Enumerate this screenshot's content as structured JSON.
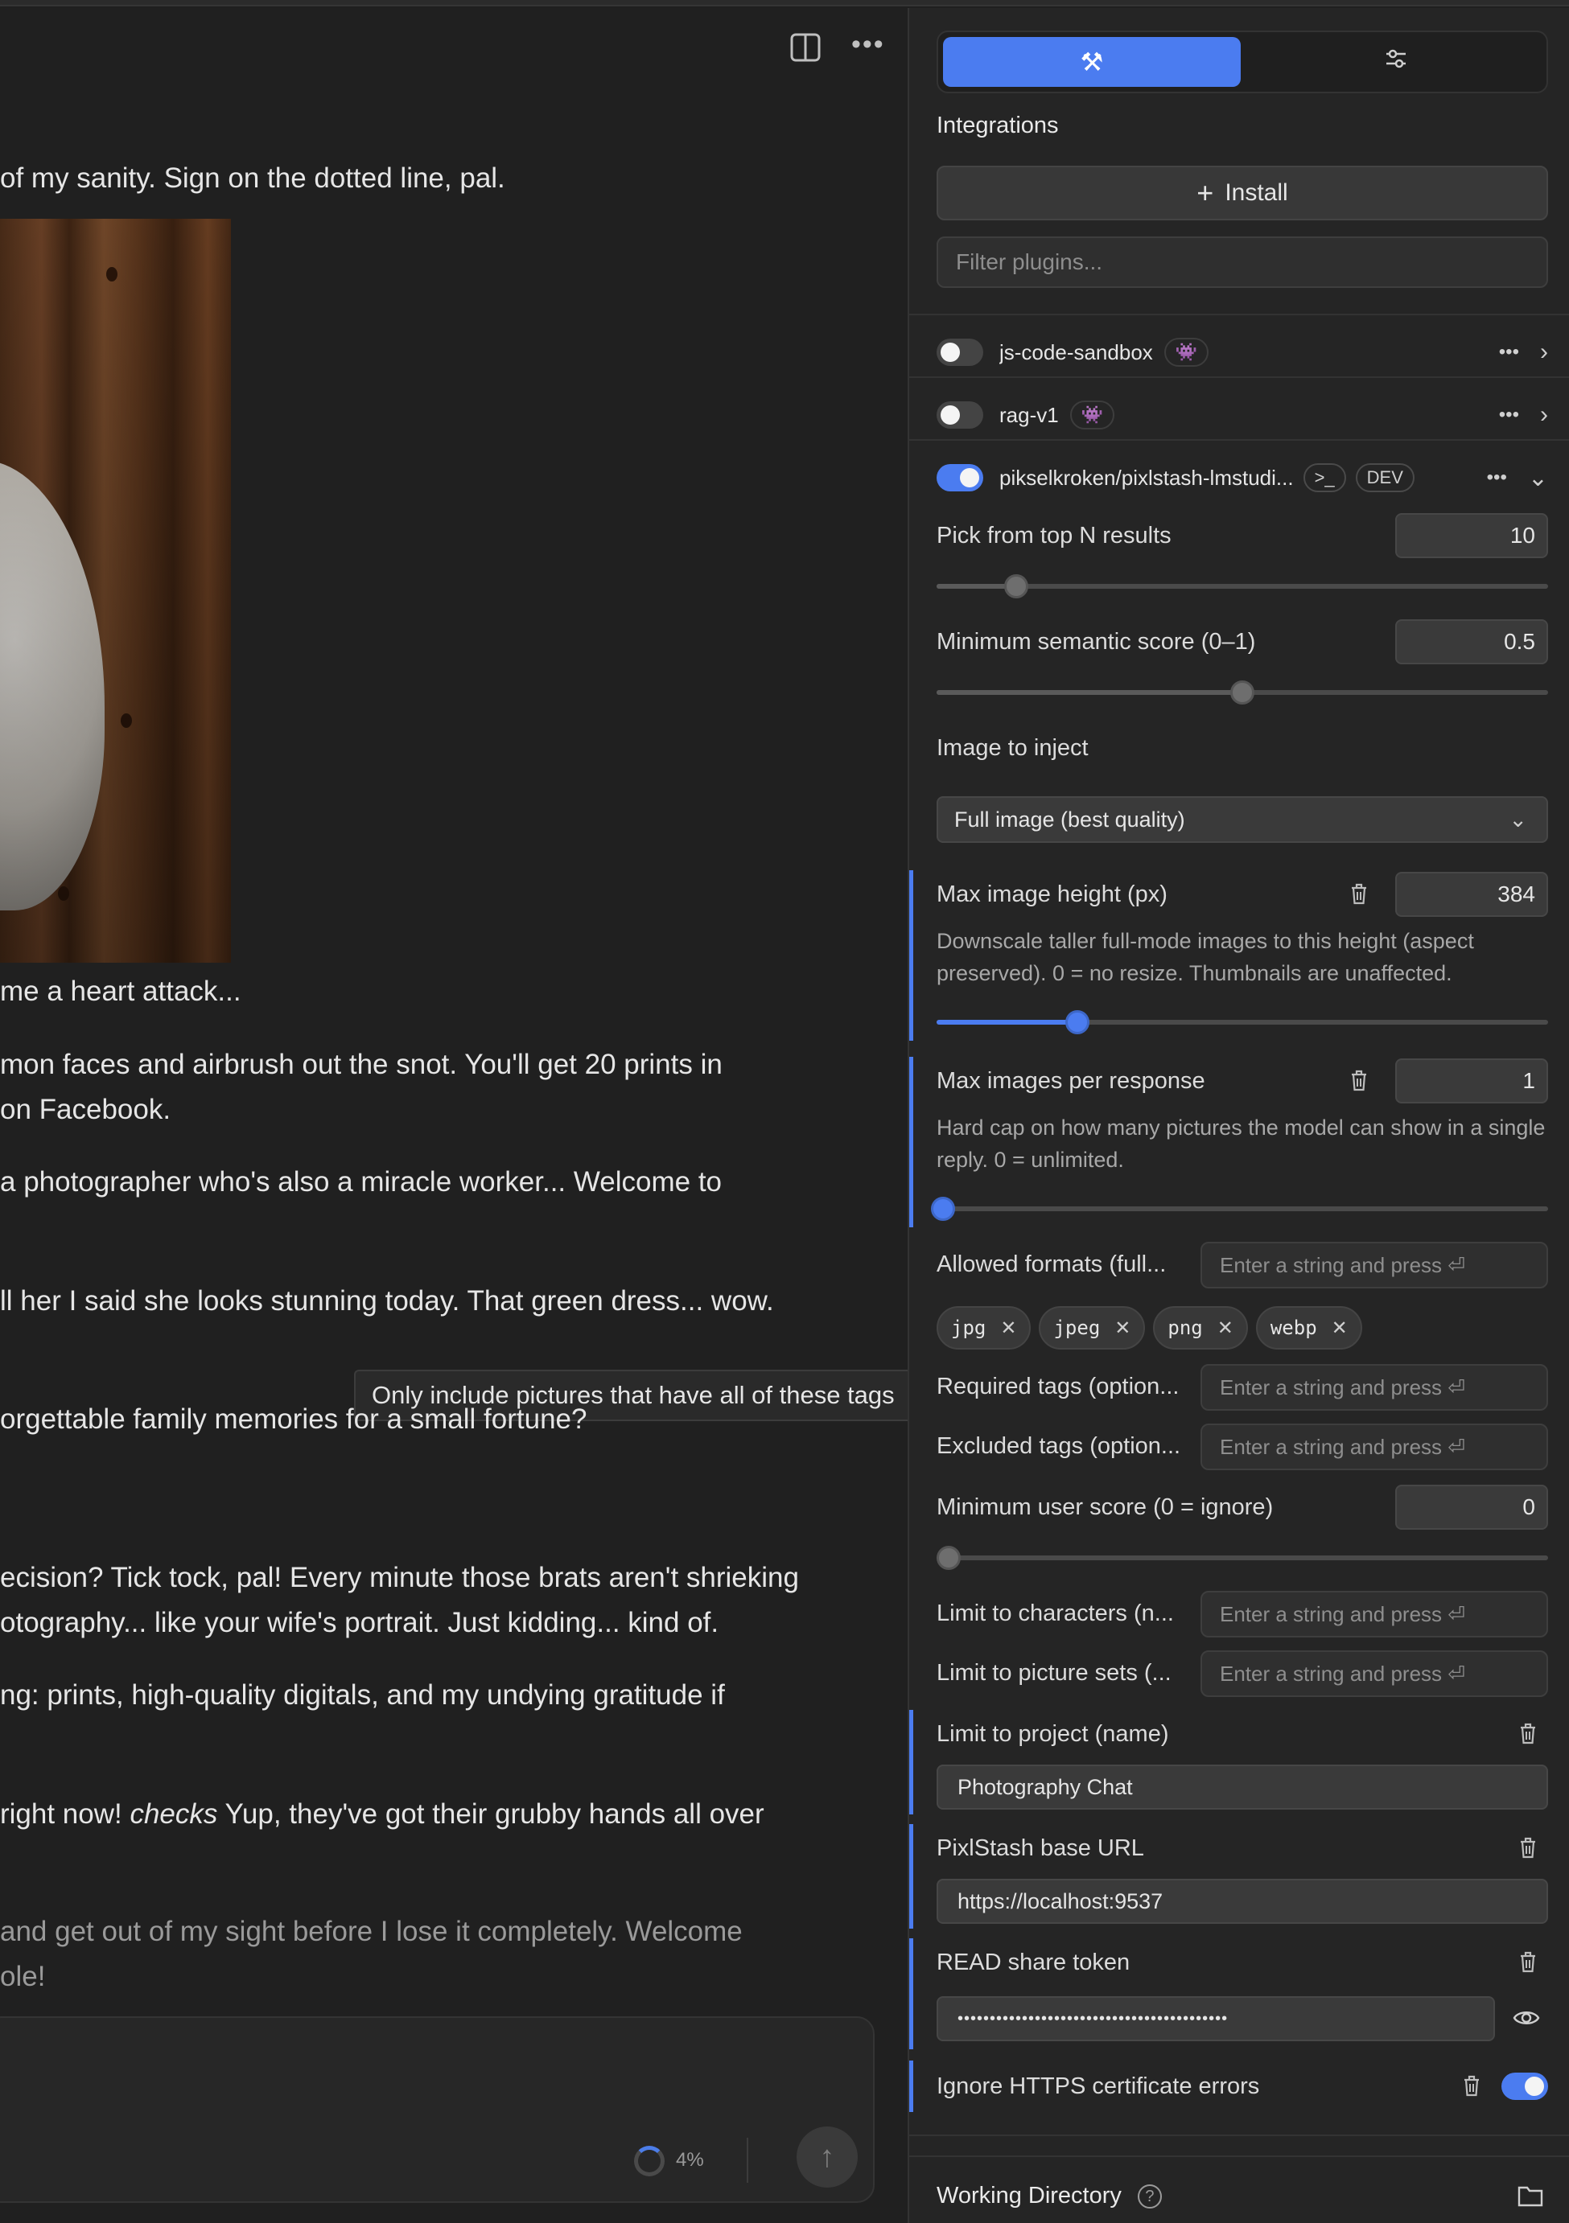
{
  "chat": {
    "header_icons": [
      "split-view-icon",
      "more-horizontal-icon"
    ],
    "lines": [
      "of my sanity. Sign on the dotted line, pal.",
      "me a heart attack...",
      "mon faces and airbrush out the snot. You'll get 20 prints in",
      "on Facebook.",
      "a photographer who's also a miracle worker... Welcome to",
      "ll her I said she looks stunning today. That green dress... wow.",
      "orgettable family memories for a small fortune?",
      "ecision? Tick tock, pal! Every minute those brats aren't shrieking",
      "otography... like your wife's portrait. Just kidding... kind of.",
      "ng: prints, high-quality digitals, and my undying gratitude if",
      "and get out of my sight before I lose it completely. Welcome",
      "ole!"
    ],
    "line_checks": {
      "before": "right now! ",
      "emph": "checks",
      "after": " Yup, they've got their grubby hands all over"
    },
    "tooltip": "Only include pictures that have all of these tags",
    "progress": "4%",
    "send_icon": "arrow-up-icon"
  },
  "panel": {
    "tabs": [
      {
        "icon": "hammer-icon",
        "glyph": "⚒",
        "active": true
      },
      {
        "icon": "sliders-icon",
        "glyph": "☰",
        "active": false
      }
    ],
    "integrations_title": "Integrations",
    "install_label": "Install",
    "filter_placeholder": "Filter plugins...",
    "plugins": [
      {
        "name": "js-code-sandbox",
        "enabled": false,
        "badge_icon": "bug-icon",
        "expanded": false
      },
      {
        "name": "rag-v1",
        "enabled": false,
        "badge_icon": "bug-icon",
        "expanded": false
      },
      {
        "name": "pikselkroken/pixlstash-lmstudi...",
        "enabled": true,
        "terminal_badge": ">_",
        "dev_badge": "DEV",
        "expanded": true
      }
    ],
    "settings": {
      "top_n": {
        "label": "Pick from top N results",
        "value": "10",
        "slider_fraction": 0.13
      },
      "min_semantic": {
        "label": "Minimum semantic score (0–1)",
        "value": "0.5",
        "slider_fraction": 0.5
      },
      "image_to_inject": {
        "label": "Image to inject",
        "selected": "Full image (best quality)"
      },
      "max_height": {
        "label": "Max image height (px)",
        "value": "384",
        "help": "Downscale taller full-mode images to this height (aspect preserved). 0 = no resize. Thumbnails are unaffected.",
        "slider_fraction": 0.23
      },
      "max_images": {
        "label": "Max images per response",
        "value": "1",
        "help": "Hard cap on how many pictures the model can show in a single reply. 0 = unlimited.",
        "slider_fraction": 0.01
      },
      "allowed_formats": {
        "label": "Allowed formats (full...",
        "placeholder": "Enter a string and press ⏎",
        "tags": [
          "jpg",
          "jpeg",
          "png",
          "webp"
        ]
      },
      "required_tags": {
        "label": "Required tags (option...",
        "placeholder": "Enter a string and press ⏎"
      },
      "excluded_tags": {
        "label": "Excluded tags (option...",
        "placeholder": "Enter a string and press ⏎"
      },
      "min_user_score": {
        "label": "Minimum user score (0 = ignore)",
        "value": "0",
        "slider_fraction": 0.0
      },
      "limit_characters": {
        "label": "Limit to characters (n...",
        "placeholder": "Enter a string and press ⏎"
      },
      "limit_picture_sets": {
        "label": "Limit to picture sets (...",
        "placeholder": "Enter a string and press ⏎"
      },
      "limit_project": {
        "label": "Limit to project (name)",
        "value": "Photography Chat"
      },
      "base_url": {
        "label": "PixlStash base URL",
        "value": "https://localhost:9537"
      },
      "share_token": {
        "label": "READ share token",
        "value": "••••••••••••••••••••••••••••••••••••••••••"
      },
      "ignore_https": {
        "label": "Ignore HTTPS certificate errors",
        "enabled": true
      }
    },
    "working_directory": "Working Directory"
  },
  "colors": {
    "accent": "#4b7cf0",
    "background": "#1f1f1f",
    "panel": "#252525"
  }
}
